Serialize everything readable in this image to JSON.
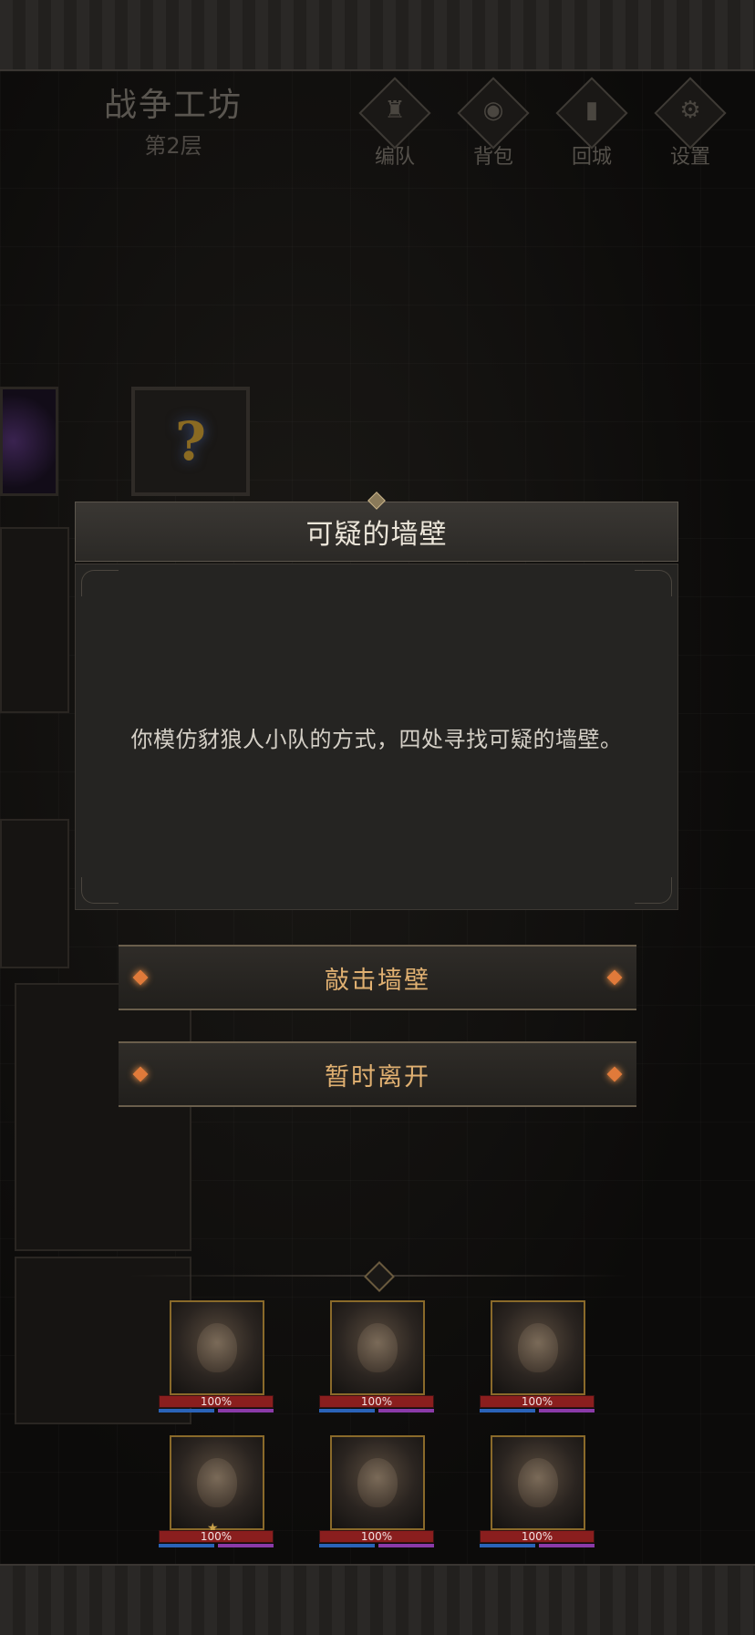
{
  "header": {
    "location_title": "战争工坊",
    "floor": "第2层"
  },
  "toolbar": [
    {
      "label": "编队",
      "icon": "helmet-icon"
    },
    {
      "label": "背包",
      "icon": "bag-icon"
    },
    {
      "label": "回城",
      "icon": "return-door-icon"
    },
    {
      "label": "设置",
      "icon": "gear-icon"
    }
  ],
  "map": {
    "mystery_tile_glyph": "?"
  },
  "event": {
    "title": "可疑的墙壁",
    "description": "你模仿豺狼人小队的方式，四处寻找可疑的墙壁。"
  },
  "choices": [
    {
      "label": "敲击墙壁"
    },
    {
      "label": "暂时离开"
    }
  ],
  "party": [
    {
      "hp": "100%",
      "hp_fraction": 1.0
    },
    {
      "hp": "100%",
      "hp_fraction": 1.0
    },
    {
      "hp": "100%",
      "hp_fraction": 1.0
    },
    {
      "hp": "100%",
      "hp_fraction": 1.0,
      "star": "★"
    },
    {
      "hp": "100%",
      "hp_fraction": 1.0
    },
    {
      "hp": "100%",
      "hp_fraction": 1.0
    }
  ],
  "colors": {
    "accent_gold": "#e0b071",
    "gem_orange": "#e07a3a",
    "hp_red": "#8a1e1e",
    "mp_blue": "#2a63b8",
    "sp_purple": "#8a3aa8"
  }
}
